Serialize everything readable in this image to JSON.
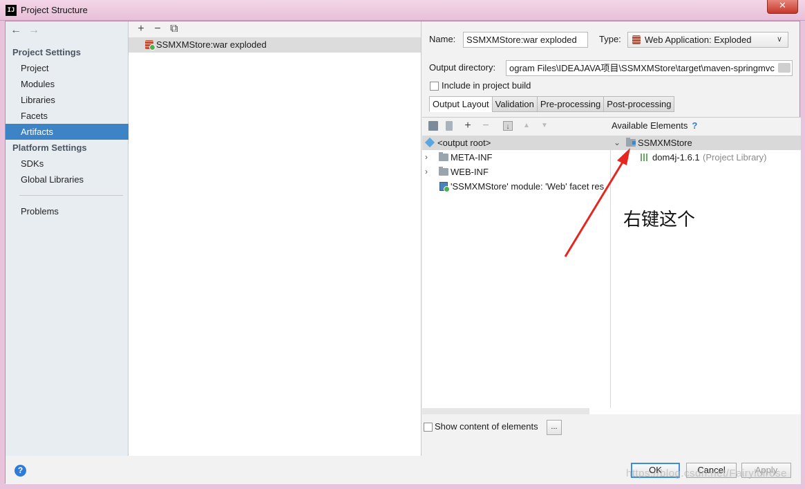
{
  "window": {
    "title": "Project Structure",
    "app_icon": "IJ",
    "close_label": "✕"
  },
  "sidebar": {
    "back_icon": "←",
    "forward_icon": "→",
    "groups": {
      "project_settings": "Project Settings",
      "platform_settings": "Platform Settings"
    },
    "items": {
      "project": "Project",
      "modules": "Modules",
      "libraries": "Libraries",
      "facets": "Facets",
      "artifacts": "Artifacts",
      "sdks": "SDKs",
      "global_libraries": "Global Libraries",
      "problems": "Problems"
    }
  },
  "artifact_list": {
    "toolbar": {
      "add": "+",
      "remove": "−",
      "copy": "⧉"
    },
    "items": [
      "SSMXMStore:war exploded"
    ]
  },
  "detail": {
    "name_label": "Name:",
    "name_value": "SSMXMStore:war exploded",
    "type_label": "Type:",
    "type_value": "Web Application: Exploded",
    "output_dir_label": "Output directory:",
    "output_dir_value": "ogram Files\\IDEAJAVA项目\\SSMXMStore\\target\\maven-springmvc",
    "include_build_label": "Include in project build",
    "tabs": [
      "Output Layout",
      "Validation",
      "Pre-processing",
      "Post-processing"
    ],
    "available_elements_label": "Available Elements",
    "help_mark": "?",
    "output_tree": {
      "root": "<output root>",
      "meta_inf": "META-INF",
      "web_inf": "WEB-INF",
      "module": "'SSMXMStore' module: 'Web' facet res"
    },
    "available_tree": {
      "project": "SSMXMStore",
      "library": "dom4j-1.6.1",
      "library_note": "(Project Library)"
    },
    "show_content_label": "Show content of elements",
    "dots_button": "..."
  },
  "annotation": {
    "text": "右键这个",
    "arrow_color": "#e8241e"
  },
  "footer": {
    "help": "?",
    "ok": "OK",
    "cancel": "Cancel",
    "apply": "Apply",
    "watermark": "https://blog.csdn.net/Fairylulrose"
  },
  "colors": {
    "selection": "#3c84c6",
    "frame": "#e9c3dc"
  }
}
